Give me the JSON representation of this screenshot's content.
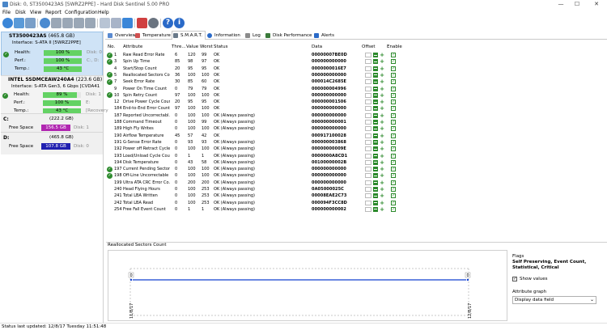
{
  "window": {
    "title": "Disk: 0, ST3500423AS [5WRZ2PPE] - Hard Disk Sentinel 5.00 PRO",
    "min_glyph": "—",
    "max_glyph": "☐",
    "close_glyph": "✕"
  },
  "menu": [
    "File",
    "Disk",
    "View",
    "Report",
    "Configuration",
    "Help"
  ],
  "disks": [
    {
      "model": "ST3500423AS",
      "size": "(465.8 GB)",
      "interface": "Interface: S-ATA II [5WRZ2PPE]",
      "health_label": "Health:",
      "health": "100 %",
      "health_extra": "Disk: 0",
      "perf_label": "Perf.:",
      "perf": "100 %",
      "perf_extra": "C:, D:",
      "temp_label": "Temp.:",
      "temp": "43 °C",
      "temp_extra": "",
      "selected": true
    },
    {
      "model": "INTEL SSDMCEAW240A4",
      "size": "(223.6 GB)",
      "interface": "Interface: S-ATA Gen3, 6 Gbps [CVDA41",
      "health_label": "Health:",
      "health": "89 %",
      "health_extra": "Disk: 1",
      "perf_label": "Perf.:",
      "perf": "100 %",
      "perf_extra": "E:",
      "temp_label": "Temp.:",
      "temp": "43 °C",
      "temp_extra": "[Recovery",
      "selected": false
    }
  ],
  "volumes": [
    {
      "letter": "C:",
      "size": "(222.2 GB)",
      "free_label": "Free Space",
      "free": "156.5 GB",
      "disk": "Disk: 1",
      "color": "#b026b0"
    },
    {
      "letter": "D:",
      "size": "(465.8 GB)",
      "free_label": "Free Space",
      "free": "107.8 GB",
      "disk": "Disk: 0",
      "color": "#1f1fb0"
    }
  ],
  "tabs": [
    {
      "label": "Overview",
      "active": false
    },
    {
      "label": "Temperature",
      "active": false
    },
    {
      "label": "S.M.A.R.T.",
      "active": true
    },
    {
      "label": "Information",
      "active": false
    },
    {
      "label": "Log",
      "active": false
    },
    {
      "label": "Disk Performance",
      "active": false
    },
    {
      "label": "Alerts",
      "active": false
    }
  ],
  "smart": {
    "headers": {
      "no": "No.",
      "attribute": "Attribute",
      "threshold": "Thre...",
      "value": "Value",
      "worst": "Worst",
      "status": "Status",
      "data": "Data",
      "offset": "Offset",
      "enable": "Enable"
    },
    "rows": [
      {
        "check": true,
        "no": "1",
        "attr": "Raw Read Error Rate",
        "thr": "6",
        "val": "120",
        "worst": "99",
        "status": "OK",
        "data": "00000007BE0D"
      },
      {
        "check": true,
        "no": "3",
        "attr": "Spin Up Time",
        "thr": "85",
        "val": "98",
        "worst": "97",
        "status": "OK",
        "data": "000000000000"
      },
      {
        "check": false,
        "no": "4",
        "attr": "Start/Stop Count",
        "thr": "20",
        "val": "95",
        "worst": "95",
        "status": "OK",
        "data": "0000000016E7"
      },
      {
        "check": true,
        "no": "5",
        "attr": "Reallocated Sectors Co...",
        "thr": "36",
        "val": "100",
        "worst": "100",
        "status": "OK",
        "data": "000000000000"
      },
      {
        "check": true,
        "no": "7",
        "attr": "Seek Error Rate",
        "thr": "30",
        "val": "85",
        "worst": "60",
        "status": "OK",
        "data": "000014C2685E"
      },
      {
        "check": false,
        "no": "9",
        "attr": "Power On Time Count",
        "thr": "0",
        "val": "79",
        "worst": "79",
        "status": "OK",
        "data": "000000004996"
      },
      {
        "check": true,
        "no": "10",
        "attr": "Spin Retry Count",
        "thr": "97",
        "val": "100",
        "worst": "100",
        "status": "OK",
        "data": "000000000000"
      },
      {
        "check": false,
        "no": "12",
        "attr": "Drive Power Cycle Count",
        "thr": "20",
        "val": "95",
        "worst": "95",
        "status": "OK",
        "data": "000000001506"
      },
      {
        "check": false,
        "no": "184",
        "attr": "End-to-End Error Count",
        "thr": "97",
        "val": "100",
        "worst": "100",
        "status": "OK",
        "data": "000000000000"
      },
      {
        "check": false,
        "no": "187",
        "attr": "Reported Uncorrectabl...",
        "thr": "0",
        "val": "100",
        "worst": "100",
        "status": "OK (Always passing)",
        "data": "000000000000"
      },
      {
        "check": false,
        "no": "188",
        "attr": "Command Timeout",
        "thr": "0",
        "val": "100",
        "worst": "99",
        "status": "OK (Always passing)",
        "data": "000000000001"
      },
      {
        "check": false,
        "no": "189",
        "attr": "High Fly Writes",
        "thr": "0",
        "val": "100",
        "worst": "100",
        "status": "OK (Always passing)",
        "data": "000000000000"
      },
      {
        "check": false,
        "no": "190",
        "attr": "Airflow Temperature",
        "thr": "45",
        "val": "57",
        "worst": "42",
        "status": "OK",
        "data": "000917100028"
      },
      {
        "check": false,
        "no": "191",
        "attr": "G-Sense Error Rate",
        "thr": "0",
        "val": "93",
        "worst": "93",
        "status": "OK (Always passing)",
        "data": "000000003868"
      },
      {
        "check": false,
        "no": "192",
        "attr": "Power off Retract Cycle...",
        "thr": "0",
        "val": "100",
        "worst": "100",
        "status": "OK (Always passing)",
        "data": "00000000009E"
      },
      {
        "check": false,
        "no": "193",
        "attr": "Load/Unload Cycle Cou...",
        "thr": "0",
        "val": "1",
        "worst": "1",
        "status": "OK (Always passing)",
        "data": "0000000A8CD1"
      },
      {
        "check": false,
        "no": "194",
        "attr": "Disk Temperature",
        "thr": "0",
        "val": "43",
        "worst": "58",
        "status": "OK (Always passing)",
        "data": "00100000002B"
      },
      {
        "check": true,
        "no": "197",
        "attr": "Current Pending Sector...",
        "thr": "0",
        "val": "100",
        "worst": "100",
        "status": "OK (Always passing)",
        "data": "000000000000"
      },
      {
        "check": true,
        "no": "198",
        "attr": "Off-Line Uncorrectable ...",
        "thr": "0",
        "val": "100",
        "worst": "100",
        "status": "OK (Always passing)",
        "data": "000000000000"
      },
      {
        "check": false,
        "no": "199",
        "attr": "Ultra ATA CRC Error Co...",
        "thr": "0",
        "val": "200",
        "worst": "200",
        "status": "OK (Always passing)",
        "data": "000000000000"
      },
      {
        "check": false,
        "no": "240",
        "attr": "Head Flying Hours",
        "thr": "0",
        "val": "100",
        "worst": "253",
        "status": "OK (Always passing)",
        "data": "0A05000025C"
      },
      {
        "check": false,
        "no": "241",
        "attr": "Total LBA Written",
        "thr": "0",
        "val": "100",
        "worst": "253",
        "status": "OK (Always passing)",
        "data": "00008EAE2C73"
      },
      {
        "check": false,
        "no": "242",
        "attr": "Total LBA Read",
        "thr": "0",
        "val": "100",
        "worst": "253",
        "status": "OK (Always passing)",
        "data": "000094F3CC8D"
      },
      {
        "check": false,
        "no": "254",
        "attr": "Free Fall Event Count",
        "thr": "0",
        "val": "1",
        "worst": "1",
        "status": "OK (Always passing)",
        "data": "000000000002"
      }
    ]
  },
  "graph": {
    "tab_label": "Reallocated Sectors Count",
    "left_value": "0",
    "right_value": "0",
    "start_date": "11/8/17",
    "end_date": "12/8/17"
  },
  "flags": {
    "title": "Flags",
    "text": "Self Preserving, Event Count, Statistical, Critical",
    "show_values": "Show values",
    "attr_graph_label": "Attribute graph",
    "attr_graph_value": "Display data field"
  },
  "statusbar": {
    "text": "Status last updated: 12/8/17 Tuesday 11:51:48"
  },
  "colors": {
    "selected_disk": "#cfe3f6",
    "health_green": "#64d264",
    "graph_line": "#1040d0",
    "check_green": "#2e8b2e"
  }
}
